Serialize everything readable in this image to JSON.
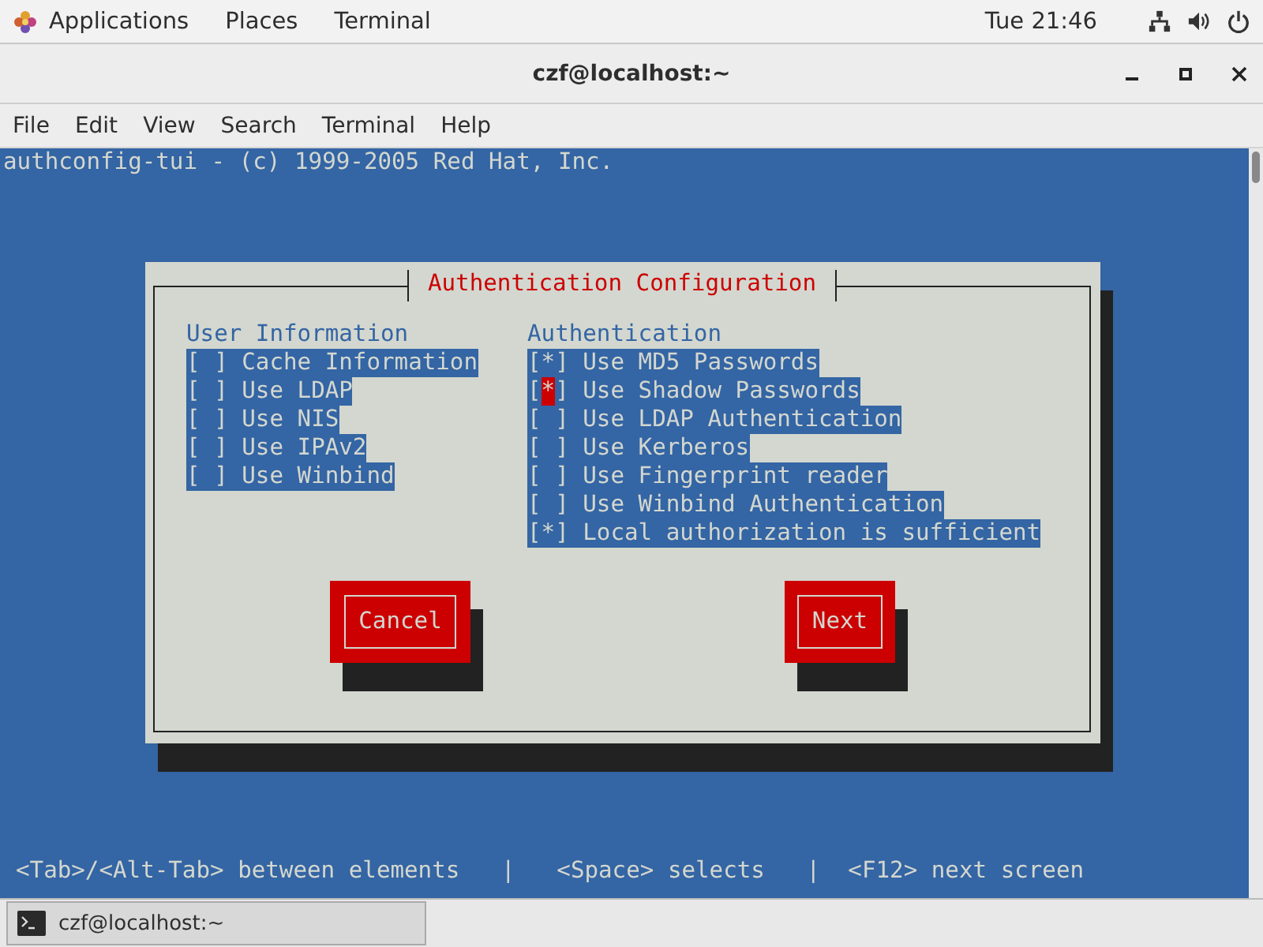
{
  "top_bar": {
    "menus": [
      "Applications",
      "Places",
      "Terminal"
    ],
    "clock": "Tue 21:46"
  },
  "window": {
    "title": "czf@localhost:~"
  },
  "menu_bar": [
    "File",
    "Edit",
    "View",
    "Search",
    "Terminal",
    "Help"
  ],
  "terminal": {
    "header_line": "authconfig-tui - (c) 1999-2005 Red Hat, Inc.",
    "dialog": {
      "title": "Authentication Configuration",
      "user_information": {
        "heading": "User Information",
        "options": [
          {
            "mark": "[ ]",
            "label": "Cache Information",
            "focused": false
          },
          {
            "mark": "[ ]",
            "label": "Use LDAP",
            "focused": false
          },
          {
            "mark": "[ ]",
            "label": "Use NIS",
            "focused": false
          },
          {
            "mark": "[ ]",
            "label": "Use IPAv2",
            "focused": false
          },
          {
            "mark": "[ ]",
            "label": "Use Winbind",
            "focused": false
          }
        ]
      },
      "authentication": {
        "heading": "Authentication",
        "options": [
          {
            "mark": "[*]",
            "label": "Use MD5 Passwords",
            "focused": false
          },
          {
            "mark": "[*]",
            "label": "Use Shadow Passwords",
            "focused": true
          },
          {
            "mark": "[ ]",
            "label": "Use LDAP Authentication",
            "focused": false
          },
          {
            "mark": "[ ]",
            "label": "Use Kerberos",
            "focused": false
          },
          {
            "mark": "[ ]",
            "label": "Use Fingerprint reader",
            "focused": false
          },
          {
            "mark": "[ ]",
            "label": "Use Winbind Authentication",
            "focused": false
          },
          {
            "mark": "[*]",
            "label": "Local authorization is sufficient",
            "focused": false
          }
        ]
      },
      "buttons": [
        "Cancel",
        "Next"
      ]
    },
    "hint_line": "<Tab>/<Alt-Tab> between elements   |   <Space> selects   |  <F12> next screen"
  },
  "taskbar": {
    "items": [
      {
        "label": "czf@localhost:~",
        "selected": true
      }
    ]
  }
}
